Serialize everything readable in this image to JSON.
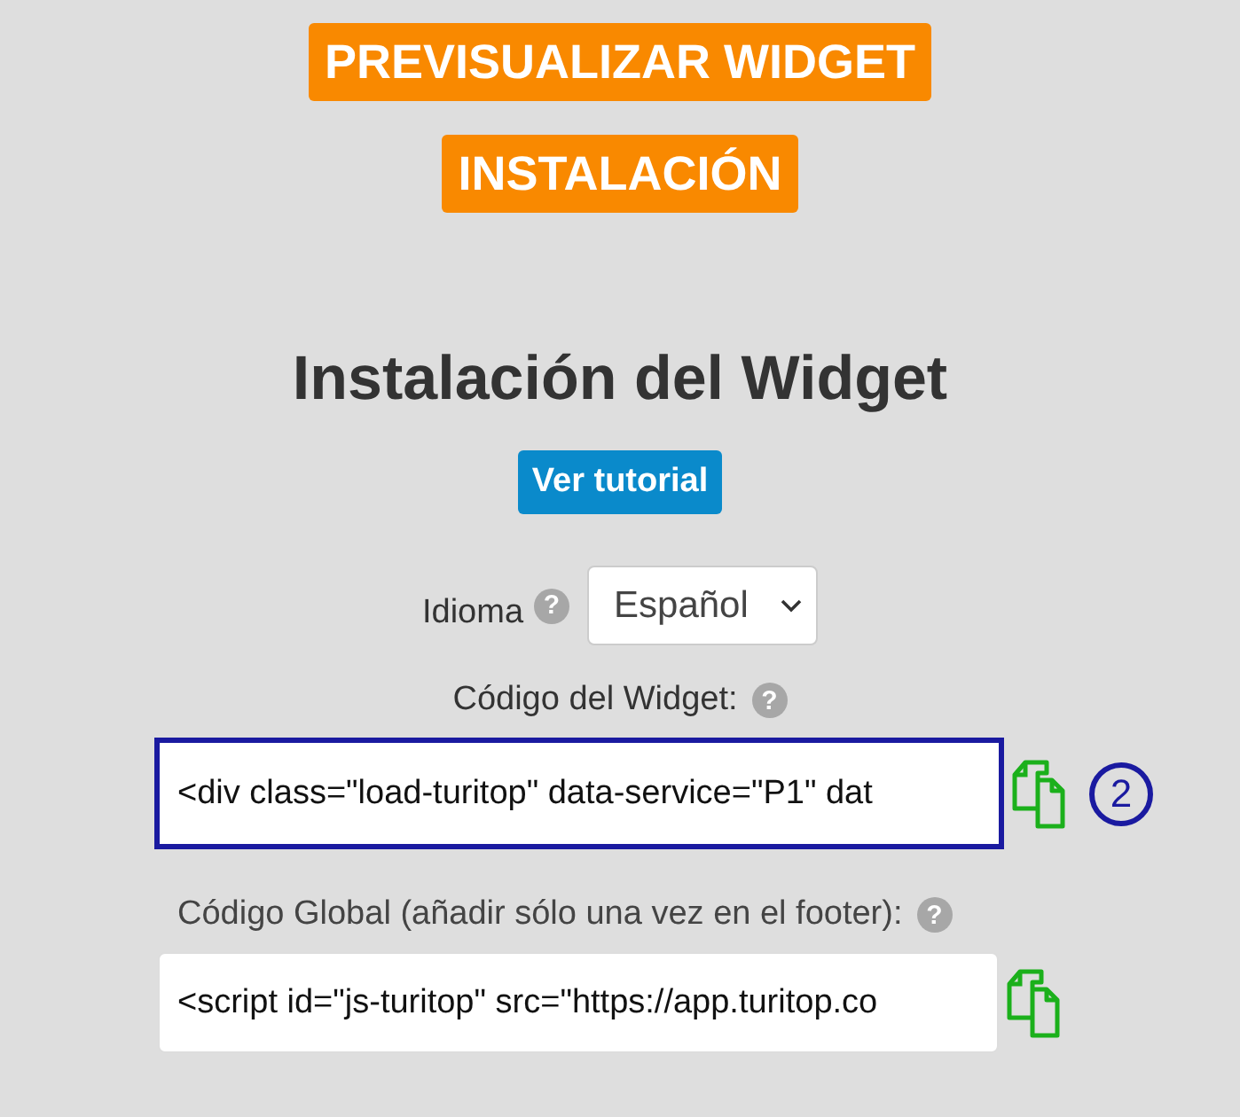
{
  "top_buttons": [
    {
      "label": "PREVISUALIZAR WIDGET"
    },
    {
      "label": "INSTALACIÓN"
    }
  ],
  "heading": "Instalación del Widget",
  "tutorial_button": "Ver tutorial",
  "language": {
    "label": "Idioma",
    "help": "?",
    "value": "Español"
  },
  "code_fields": [
    {
      "label": "Código del Widget:",
      "help": "?",
      "value": "<div class=\"load-turitop\" data-service=\"P1\" dat",
      "highlighted": true,
      "annotation": "2"
    },
    {
      "label": "Código Global (añadir sólo una vez en el footer):",
      "help": "?",
      "value": "<script id=\"js-turitop\" src=\"https://app.turitop.co",
      "highlighted": false
    }
  ]
}
